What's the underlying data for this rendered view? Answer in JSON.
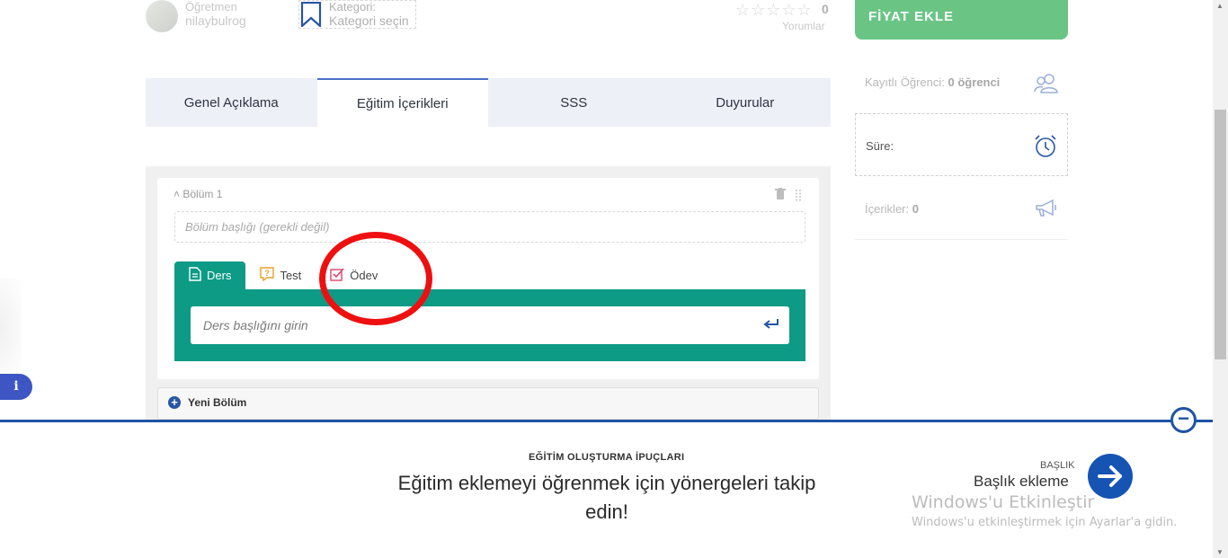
{
  "course_header": {
    "teacher_label": "Öğretmen",
    "teacher_name": "nilaybulrog",
    "category_label": "Kategori:",
    "category_value": "Kategori seçin",
    "stars": "☆☆☆☆☆",
    "rating": "0",
    "reviews_label": "Yorumlar"
  },
  "sidebar": {
    "price_button": "FİYAT EKLE",
    "enrolled_label": "Kayıtlı Öğrenci:",
    "enrolled_value": "0 öğrenci",
    "duration_label": "Süre:",
    "contents_label": "İçerikler:",
    "contents_value": "0"
  },
  "tabs": [
    {
      "label": "Genel Açıklama"
    },
    {
      "label": "Eğitim İçerikleri"
    },
    {
      "label": "SSS"
    },
    {
      "label": "Duyurular"
    }
  ],
  "section": {
    "label": "Bölüm 1",
    "title_placeholder": "Bölüm başlığı (gerekli değil)",
    "lesson_tabs": [
      {
        "label": "Ders"
      },
      {
        "label": "Test"
      },
      {
        "label": "Ödev"
      }
    ],
    "lesson_placeholder": "Ders başlığını girin",
    "new_section": "Yeni Bölüm"
  },
  "info_badge": "i",
  "tips": {
    "kicker": "EĞİTİM OLUŞTURMA İPUÇLARI",
    "title": "Eğitim eklemeyi öğrenmek için yönergeleri takip edin!",
    "next_kicker": "BAŞLIK",
    "next_title": "Başlık ekleme"
  },
  "windows_watermark": {
    "title": "Windows'u Etkinleştir",
    "subtitle": "Windows'u etkinleştirmek için Ayarlar'a gidin."
  },
  "colors": {
    "accent_green": "#6ac585",
    "lesson_teal": "#0d9b86",
    "brand_blue": "#1f53a6",
    "highlight_red": "#ee1010"
  }
}
